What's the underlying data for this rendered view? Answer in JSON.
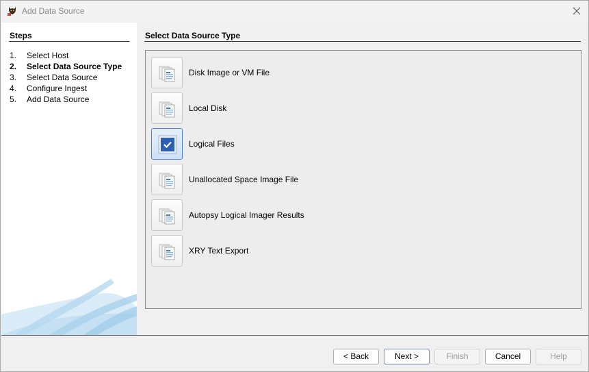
{
  "window": {
    "title": "Add Data Source",
    "app_icon": "autopsy-dog-icon",
    "close_icon": "close-icon"
  },
  "steps": {
    "heading": "Steps",
    "items": [
      {
        "num": "1.",
        "label": "Select Host",
        "active": false
      },
      {
        "num": "2.",
        "label": "Select Data Source Type",
        "active": true
      },
      {
        "num": "3.",
        "label": "Select Data Source",
        "active": false
      },
      {
        "num": "4.",
        "label": "Configure Ingest",
        "active": false
      },
      {
        "num": "5.",
        "label": "Add Data Source",
        "active": false
      }
    ]
  },
  "main": {
    "heading": "Select Data Source Type",
    "types": [
      {
        "label": "Disk Image or VM File",
        "icon": "document-stack-icon",
        "selected": false
      },
      {
        "label": "Local Disk",
        "icon": "document-stack-icon",
        "selected": false
      },
      {
        "label": "Logical Files",
        "icon": "checked-icon",
        "selected": true
      },
      {
        "label": "Unallocated Space Image File",
        "icon": "document-stack-icon",
        "selected": false
      },
      {
        "label": "Autopsy Logical Imager Results",
        "icon": "document-stack-icon",
        "selected": false
      },
      {
        "label": "XRY Text Export",
        "icon": "document-stack-icon",
        "selected": false
      }
    ]
  },
  "buttons": {
    "back": "< Back",
    "next": "Next >",
    "finish": "Finish",
    "cancel": "Cancel",
    "help": "Help"
  },
  "colors": {
    "selected_border": "#4a7cc9",
    "selected_fill": "#2f5fb3"
  }
}
